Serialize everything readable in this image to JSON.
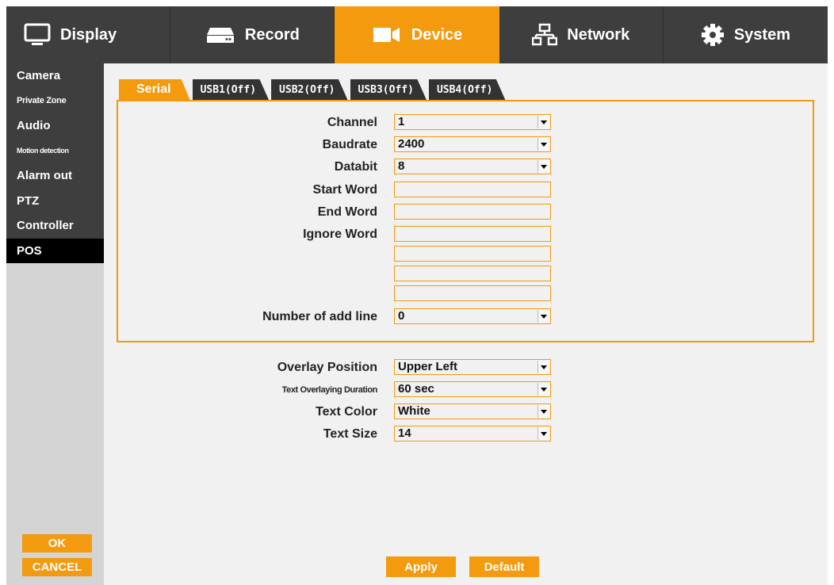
{
  "top_tabs": [
    {
      "label": "Display",
      "icon": "monitor-icon"
    },
    {
      "label": "Record",
      "icon": "recorder-icon"
    },
    {
      "label": "Device",
      "icon": "camera-icon",
      "active": true
    },
    {
      "label": "Network",
      "icon": "network-icon"
    },
    {
      "label": "System",
      "icon": "gear-icon"
    }
  ],
  "sidebar": {
    "items": [
      {
        "label": "Camera"
      },
      {
        "label": "Private Zone"
      },
      {
        "label": "Audio"
      },
      {
        "label": "Motion detection"
      },
      {
        "label": "Alarm out"
      },
      {
        "label": "PTZ"
      },
      {
        "label": "Controller"
      },
      {
        "label": "POS",
        "active": true
      }
    ],
    "ok_label": "OK",
    "cancel_label": "CANCEL"
  },
  "sub_tabs": [
    "Serial",
    "USB1(Off)",
    "USB2(Off)",
    "USB3(Off)",
    "USB4(Off)"
  ],
  "serial": {
    "channel": {
      "label": "Channel",
      "value": "1"
    },
    "baudrate": {
      "label": "Baudrate",
      "value": "2400"
    },
    "databit": {
      "label": "Databit",
      "value": "8"
    },
    "start_word": {
      "label": "Start Word",
      "value": ""
    },
    "end_word": {
      "label": "End Word",
      "value": ""
    },
    "ignore_word": {
      "label": "Ignore Word",
      "values": [
        "",
        "",
        "",
        ""
      ]
    },
    "add_line": {
      "label": "Number of add line",
      "value": "0"
    }
  },
  "overlay": {
    "position": {
      "label": "Overlay Position",
      "value": "Upper Left"
    },
    "duration": {
      "label": "Text Overlaying Duration",
      "value": "60 sec"
    },
    "color": {
      "label": "Text Color",
      "value": "White"
    },
    "size": {
      "label": "Text Size",
      "value": "14"
    }
  },
  "buttons": {
    "apply": "Apply",
    "default": "Default"
  },
  "colors": {
    "accent": "#f49a0e",
    "dark": "#3e3e3e"
  }
}
